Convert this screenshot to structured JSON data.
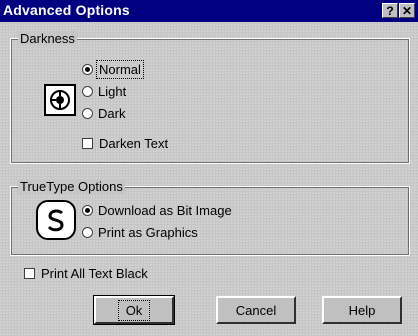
{
  "window": {
    "title": "Advanced Options",
    "help_button": "?",
    "close_button": "✕"
  },
  "darkness": {
    "legend": "Darkness",
    "options": [
      {
        "label": "Normal",
        "selected": true
      },
      {
        "label": "Light",
        "selected": false
      },
      {
        "label": "Dark",
        "selected": false
      }
    ],
    "darken_text": {
      "label": "Darken Text",
      "checked": false
    }
  },
  "truetype": {
    "legend": "TrueType Options",
    "options": [
      {
        "label": "Download as Bit Image",
        "selected": true
      },
      {
        "label": "Print as Graphics",
        "selected": false
      }
    ]
  },
  "print_all_black": {
    "label": "Print All Text Black",
    "checked": false
  },
  "buttons": {
    "ok": "Ok",
    "cancel": "Cancel",
    "help": "Help"
  },
  "icons": {
    "darkness": "printer-dial-icon",
    "truetype": "font-s-icon"
  }
}
